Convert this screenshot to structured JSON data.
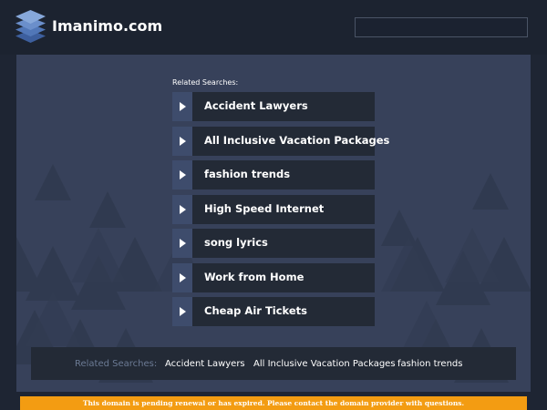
{
  "header": {
    "site_title": "Imanimo.com",
    "logo_icon": "stacked-layers-icon",
    "search_value": ""
  },
  "main": {
    "related_label": "Related Searches:",
    "links": [
      {
        "label": "Accident Lawyers"
      },
      {
        "label": "All Inclusive Vacation Packages"
      },
      {
        "label": "fashion trends"
      },
      {
        "label": "High Speed Internet"
      },
      {
        "label": "song lyrics"
      },
      {
        "label": "Work from Home"
      },
      {
        "label": "Cheap Air Tickets"
      }
    ],
    "link_icon": "play-arrow-icon"
  },
  "bottom_bar": {
    "label": "Related Searches:",
    "links": [
      "Accident Lawyers",
      "All Inclusive Vacation Packages",
      "fashion trends"
    ]
  },
  "notice": {
    "text": "This domain is pending renewal or has expired. Please contact the domain provider with questions."
  },
  "colors": {
    "background": "#1e2533",
    "panel": "#37415a",
    "link_bg": "#232a36",
    "arrow_bg": "#3e4c6c",
    "notice_bg": "#f39c12"
  }
}
